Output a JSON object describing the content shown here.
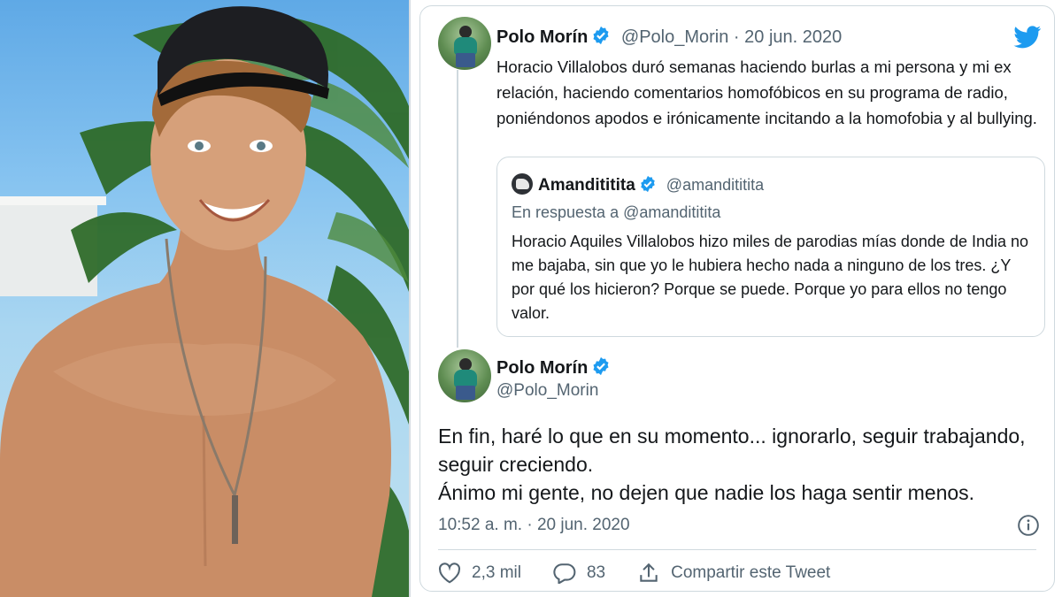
{
  "photo": {
    "subject": "shirtless young man in black cap smiling, palm trees and sky behind"
  },
  "tweet1": {
    "author_name": "Polo Morín",
    "handle": "@Polo_Morin",
    "separator": "·",
    "date": "20 jun. 2020",
    "text": "Horacio Villalobos duró semanas haciendo burlas a mi persona y mi ex relación, haciendo comentarios homofóbicos en su programa de radio, poniéndonos apodos e irónicamente incitando a la homofobia y al bullying."
  },
  "quoted": {
    "author_name": "Amandititita",
    "handle": "@amandititita",
    "reply_to": "En respuesta a @amandititita",
    "text": "Horacio Aquiles Villalobos hizo miles de parodias mías donde de India no me bajaba, sin que yo le hubiera hecho nada a ninguno de los tres. ¿Y por qué los hicieron? Porque se puede. Porque yo para ellos no tengo valor."
  },
  "tweet2": {
    "author_name": "Polo Morín",
    "handle": "@Polo_Morin",
    "line1": "En fin, haré lo que en su momento... ignorarlo, seguir trabajando, seguir creciendo.",
    "line2": "Ánimo mi gente, no dejen que nadie los haga sentir menos.",
    "time": "10:52 a. m.",
    "separator": "·",
    "date": "20 jun. 2020"
  },
  "actions": {
    "likes": "2,3 mil",
    "replies": "83",
    "share_label": "Compartir este Tweet"
  },
  "colors": {
    "twitter_blue": "#1d9bf0",
    "text": "#14171a",
    "muted": "#536471",
    "border": "#cfd9de"
  },
  "icons": [
    "twitter-bird-icon",
    "verified-badge-icon",
    "info-icon",
    "heart-icon",
    "reply-bubble-icon",
    "share-icon"
  ]
}
